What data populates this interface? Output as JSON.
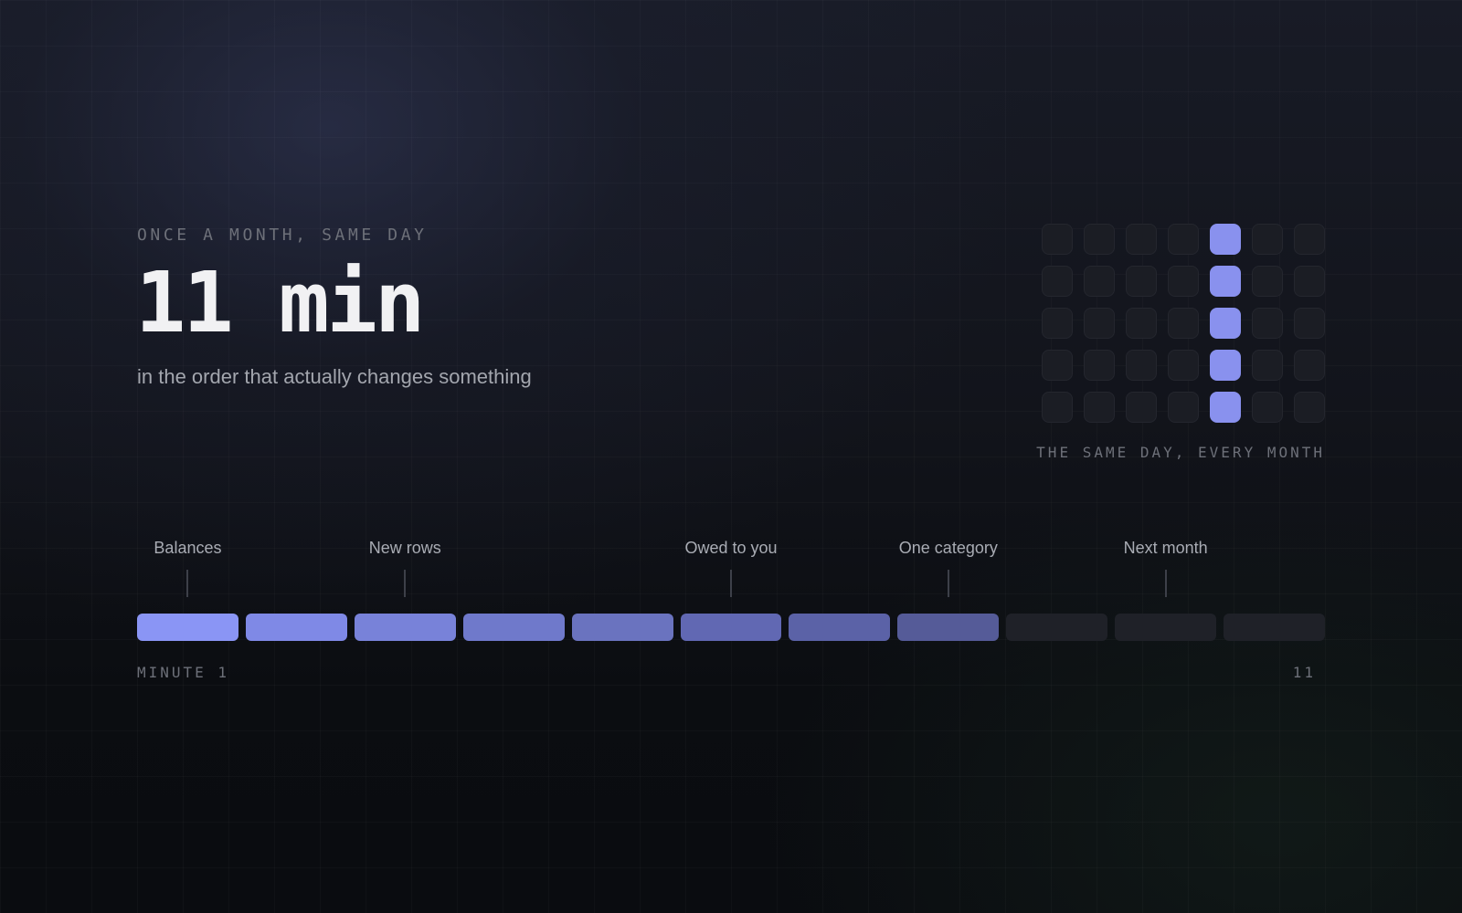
{
  "hero": {
    "eyebrow": "ONCE A MONTH, SAME DAY",
    "headline": "11 min",
    "subhead": "in the order that actually changes something"
  },
  "calendar": {
    "columns": 7,
    "rows": 5,
    "highlighted_column": 5,
    "caption": "THE SAME DAY, EVERY MONTH",
    "accent_color": "#8991ee",
    "inactive_color": "#1b1d24"
  },
  "timeline": {
    "total_minutes": 11,
    "filled_minutes": 8,
    "start_label": "MINUTE 1",
    "end_label": "11",
    "segment_colors": [
      "#8a95f5",
      "#7f89e6",
      "#7882d9",
      "#6f79cb",
      "#6a73bf",
      "#6168b3",
      "#5b62a7",
      "#555b98"
    ],
    "empty_color": "#1f2128",
    "steps": [
      {
        "label": "Balances",
        "minute": 1
      },
      {
        "label": "New rows",
        "minute": 3
      },
      {
        "label": "Owed to you",
        "minute": 6
      },
      {
        "label": "One category",
        "minute": 8
      },
      {
        "label": "Next month",
        "minute": 10
      }
    ]
  }
}
